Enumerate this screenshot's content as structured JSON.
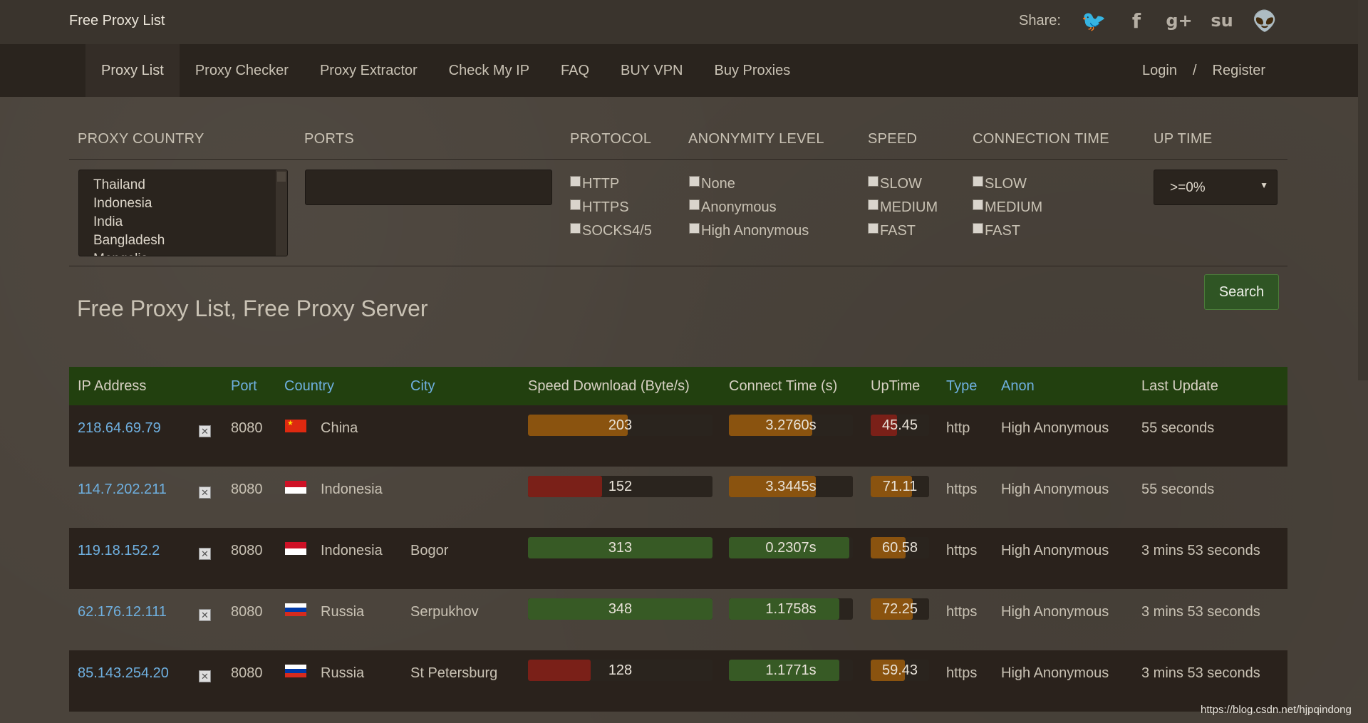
{
  "site": {
    "title": "Free Proxy List",
    "share_label": "Share:"
  },
  "share_icons": [
    {
      "name": "twitter",
      "glyph": "🐦"
    },
    {
      "name": "facebook",
      "glyph": "f"
    },
    {
      "name": "google-plus",
      "glyph": "g+"
    },
    {
      "name": "stumbleupon",
      "glyph": "su"
    },
    {
      "name": "reddit",
      "glyph": "👽"
    }
  ],
  "nav": {
    "items": [
      "Proxy List",
      "Proxy Checker",
      "Proxy Extractor",
      "Check My IP",
      "FAQ",
      "BUY VPN",
      "Buy Proxies"
    ],
    "login": "Login",
    "separator": "/",
    "register": "Register"
  },
  "filters": {
    "headers": {
      "country": "PROXY COUNTRY",
      "ports": "PORTS",
      "protocol": "PROTOCOL",
      "anonymity": "ANONYMITY LEVEL",
      "speed": "SPEED",
      "connection": "CONNECTION TIME",
      "uptime": "UP TIME"
    },
    "countries": [
      "Thailand",
      "Indonesia",
      "India",
      "Bangladesh",
      "Mongolia"
    ],
    "ports_value": "",
    "protocol": [
      "HTTP",
      "HTTPS",
      "SOCKS4/5"
    ],
    "anonymity": [
      "None",
      "Anonymous",
      "High Anonymous"
    ],
    "speed": [
      "SLOW",
      "MEDIUM",
      "FAST"
    ],
    "connection": [
      "SLOW",
      "MEDIUM",
      "FAST"
    ],
    "uptime_selected": ">=0%"
  },
  "search_label": "Search",
  "page_title": "Free Proxy List, Free Proxy Server",
  "table": {
    "headers": {
      "ip": "IP Address",
      "port": "Port",
      "country": "Country",
      "city": "City",
      "speed": "Speed Download (Byte/s)",
      "connect": "Connect Time (s)",
      "uptime": "UpTime",
      "type": "Type",
      "anon": "Anon",
      "last": "Last Update"
    },
    "rows": [
      {
        "ip": "218.64.69.79",
        "port": "8080",
        "flag": "cn",
        "country": "China",
        "city": "",
        "speed": "203",
        "speed_pct": 54,
        "speed_color": "orange",
        "connect": "3.2760s",
        "connect_pct": 67,
        "connect_color": "orange",
        "uptime": "45.45",
        "uptime_pct": 45,
        "uptime_color": "red",
        "type": "http",
        "anon": "High Anonymous",
        "last": "55 seconds"
      },
      {
        "ip": "114.7.202.211",
        "port": "8080",
        "flag": "id",
        "country": "Indonesia",
        "city": "",
        "speed": "152",
        "speed_pct": 40,
        "speed_color": "red",
        "connect": "3.3445s",
        "connect_pct": 70,
        "connect_color": "orange",
        "uptime": "71.11",
        "uptime_pct": 71,
        "uptime_color": "orange",
        "type": "https",
        "anon": "High Anonymous",
        "last": "55 seconds"
      },
      {
        "ip": "119.18.152.2",
        "port": "8080",
        "flag": "id",
        "country": "Indonesia",
        "city": "Bogor",
        "speed": "313",
        "speed_pct": 100,
        "speed_color": "green",
        "connect": "0.2307s",
        "connect_pct": 97,
        "connect_color": "green",
        "uptime": "60.58",
        "uptime_pct": 60,
        "uptime_color": "orange",
        "type": "https",
        "anon": "High Anonymous",
        "last": "3 mins 53 seconds"
      },
      {
        "ip": "62.176.12.111",
        "port": "8080",
        "flag": "ru",
        "country": "Russia",
        "city": "Serpukhov",
        "speed": "348",
        "speed_pct": 100,
        "speed_color": "green",
        "connect": "1.1758s",
        "connect_pct": 89,
        "connect_color": "green",
        "uptime": "72.25",
        "uptime_pct": 72,
        "uptime_color": "orange",
        "type": "https",
        "anon": "High Anonymous",
        "last": "3 mins 53 seconds"
      },
      {
        "ip": "85.143.254.20",
        "port": "8080",
        "flag": "ru",
        "country": "Russia",
        "city": "St Petersburg",
        "speed": "128",
        "speed_pct": 34,
        "speed_color": "red",
        "connect": "1.1771s",
        "connect_pct": 89,
        "connect_color": "green",
        "uptime": "59.43",
        "uptime_pct": 59,
        "uptime_color": "orange",
        "type": "https",
        "anon": "High Anonymous",
        "last": "3 mins 53 seconds"
      }
    ]
  },
  "watermark": "https://blog.csdn.net/hjpqindong"
}
